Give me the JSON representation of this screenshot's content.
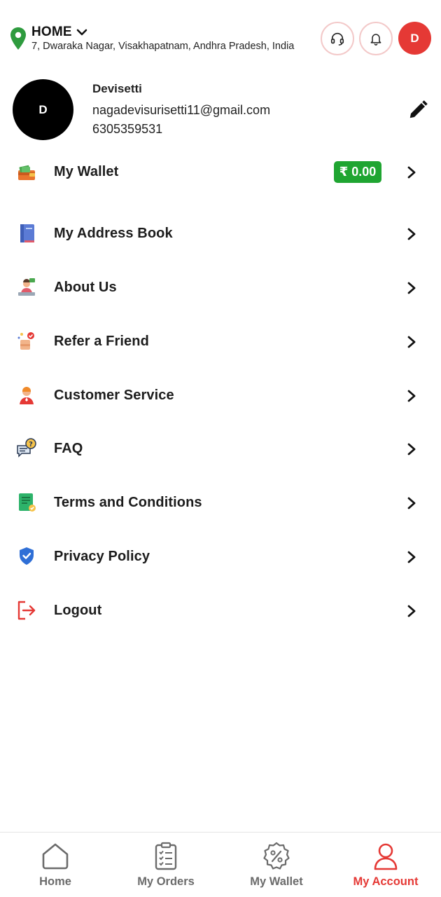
{
  "header": {
    "location_title": "HOME",
    "location_address": "7, Dwaraka Nagar, Visakhapatnam, Andhra Pradesh, India",
    "avatar_initial": "D",
    "icons": {
      "pin": "location-pin-icon",
      "support": "headset-icon",
      "notifications": "bell-icon"
    }
  },
  "profile": {
    "avatar_initial": "D",
    "name": "Devisetti",
    "email": "nagadevisurisetti11@gmail.com",
    "phone": "6305359531"
  },
  "menu": [
    {
      "label": "My Wallet",
      "icon": "wallet-icon",
      "badge": "₹ 0.00"
    },
    {
      "label": "My Address Book",
      "icon": "address-book-icon"
    },
    {
      "label": "About Us",
      "icon": "about-us-icon"
    },
    {
      "label": "Refer a Friend",
      "icon": "refer-friend-icon"
    },
    {
      "label": "Customer Service",
      "icon": "customer-service-icon"
    },
    {
      "label": "FAQ",
      "icon": "faq-icon"
    },
    {
      "label": "Terms and Conditions",
      "icon": "terms-icon"
    },
    {
      "label": "Privacy Policy",
      "icon": "shield-icon"
    },
    {
      "label": "Logout",
      "icon": "logout-icon"
    }
  ],
  "bottom_nav": [
    {
      "label": "Home",
      "icon": "home-icon",
      "active": false
    },
    {
      "label": "My Orders",
      "icon": "orders-icon",
      "active": false
    },
    {
      "label": "My Wallet",
      "icon": "discount-icon",
      "active": false
    },
    {
      "label": "My Account",
      "icon": "account-icon",
      "active": true
    }
  ],
  "colors": {
    "accent": "#e53935",
    "wallet_badge": "#1fa531",
    "pin": "#2e9b3e",
    "inactive_nav": "#6b6b6b"
  }
}
